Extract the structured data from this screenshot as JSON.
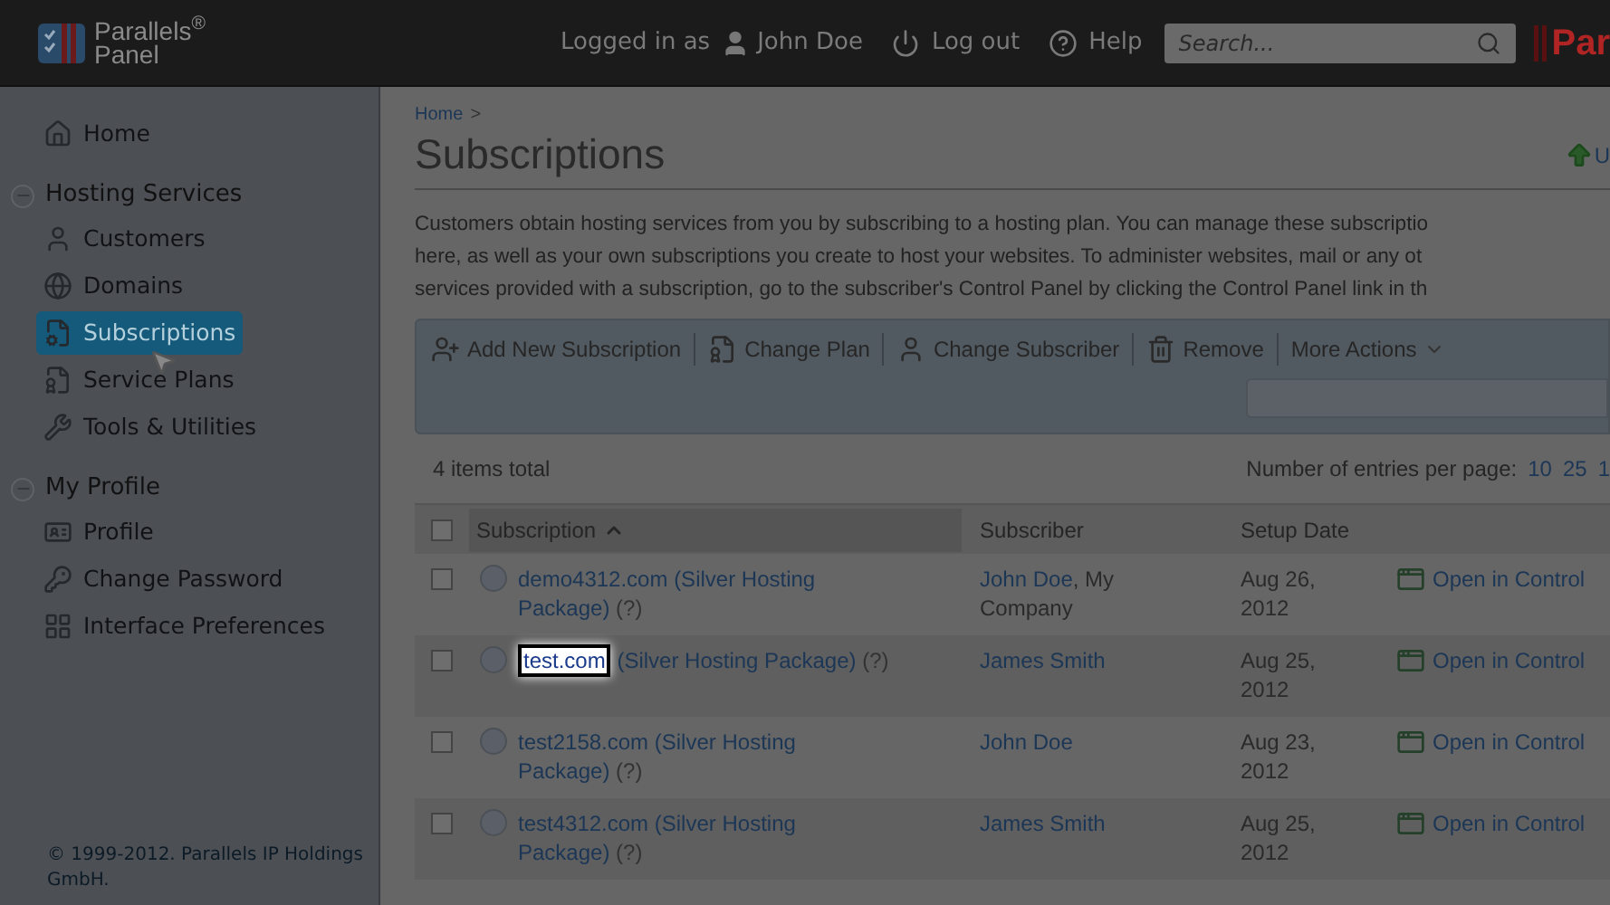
{
  "header": {
    "logo": {
      "name": "Parallels$^{®}$",
      "product": "Panel"
    },
    "logged_in_label": "Logged in as",
    "user": "John Doe",
    "logout": "Log out",
    "help": "Help",
    "search": {
      "placeholder": "Search..."
    },
    "brand_cut": "Par"
  },
  "sidebar": {
    "items": [
      {
        "kind": "link",
        "label": "Home",
        "selected": false
      },
      {
        "kind": "group",
        "label": "Hosting Services",
        "expanded": true,
        "children": [
          {
            "label": "Customers",
            "selected": false
          },
          {
            "label": "Domains",
            "selected": false
          },
          {
            "label": "Subscriptions",
            "selected": true
          },
          {
            "label": "Service Plans",
            "selected": false
          },
          {
            "label": "Tools & Utilities",
            "selected": false
          }
        ]
      },
      {
        "kind": "group",
        "label": "My Profile",
        "expanded": true,
        "children": [
          {
            "label": "Profile",
            "selected": false
          },
          {
            "label": "Change Password",
            "selected": false
          },
          {
            "label": "Interface Preferences",
            "selected": false
          }
        ]
      }
    ],
    "footer": "© 1999-2012. Parallels IP Holdings GmbH."
  },
  "breadcrumb": [
    "Home",
    ">"
  ],
  "title": "Subscriptions",
  "top_link": "U",
  "description": [
    "Customers obtain hosting services from you by subscribing to a hosting plan. You can manage these subscriptio",
    "here, as well as your own subscriptions you create to host your websites. To administer websites, mail or any ot",
    "services provided with a subscription, go to the subscriber's Control Panel by clicking the Control Panel link in th"
  ],
  "toolbar": {
    "buttons": [
      {
        "kind": "action",
        "label": "Add New Subscription"
      },
      {
        "kind": "action",
        "label": "Change Plan"
      },
      {
        "kind": "action",
        "label": "Change Subscriber"
      },
      {
        "kind": "action",
        "label": "Remove"
      },
      {
        "kind": "menu",
        "label": "More Actions"
      }
    ]
  },
  "items_total": "4 items total",
  "per_page": {
    "label": "Number of entries per page:",
    "options": [
      "10",
      "25",
      "1"
    ]
  },
  "table": {
    "select_all": {
      "checked": false
    },
    "columns": [
      {
        "label": "Subscription",
        "sorted": true
      },
      {
        "label": "Subscriber",
        "sorted": false
      },
      {
        "label": "Setup Date",
        "sorted": false
      }
    ],
    "rows": [
      {
        "checked": false,
        "domain": "demo4312.com",
        "domain_highlighted": false,
        "plan": "(Silver Hosting Package)",
        "help": "(?)",
        "subscriber": "John Doe",
        "company": ", My Company",
        "date": "Aug 26, 2012",
        "action": "Open in Control"
      },
      {
        "checked": false,
        "domain": "test.com",
        "domain_highlighted": true,
        "plan": "(Silver Hosting Package)",
        "help": "(?)",
        "subscriber": "James Smith",
        "date": "Aug 25, 2012",
        "action": "Open in Control"
      },
      {
        "checked": false,
        "domain": "test2158.com",
        "domain_highlighted": false,
        "plan": "(Silver Hosting Package)",
        "help": "(?)",
        "subscriber": "John Doe",
        "date": "Aug 23, 2012",
        "action": "Open in Control"
      },
      {
        "checked": false,
        "domain": "test4312.com",
        "domain_highlighted": false,
        "plan": "(Silver Hosting Package)",
        "help": "(?)",
        "subscriber": "James Smith",
        "date": "Aug 25, 2012",
        "action": "Open in Control"
      }
    ]
  }
}
